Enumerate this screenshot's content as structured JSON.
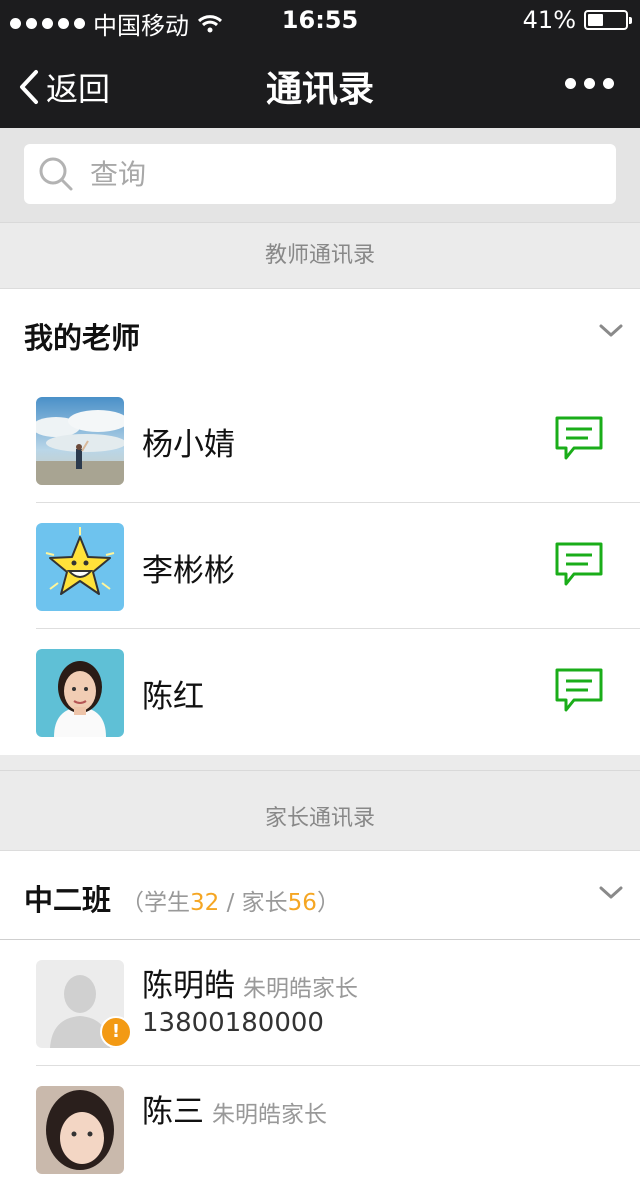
{
  "status_bar": {
    "carrier": "中国移动",
    "time": "16:55",
    "battery": "41%",
    "battery_level": 0.41
  },
  "nav": {
    "back_label": "返回",
    "title": "通讯录"
  },
  "search": {
    "placeholder": "查询"
  },
  "teacher_section": {
    "header": "教师通讯录",
    "group_title": "我的老师",
    "teachers": [
      {
        "name": "杨小婧"
      },
      {
        "name": "李彬彬"
      },
      {
        "name": "陈红"
      }
    ]
  },
  "parent_section": {
    "header": "家长通讯录",
    "group_title": "中二班",
    "counts_open": "（学生",
    "students": "32",
    "counts_sep": " / 家长",
    "parents": "56",
    "counts_close": "）",
    "parents_list": [
      {
        "name": "陈明皓",
        "relation": "朱明皓家长",
        "phone": "13800180000",
        "warning": "!"
      },
      {
        "name": "陈三",
        "relation": "朱明皓家长"
      }
    ]
  },
  "colors": {
    "bar_bg": "#1c1c1e",
    "message_icon": "#1aad19",
    "count_accent": "#f5a623",
    "warning": "#f39a14"
  }
}
